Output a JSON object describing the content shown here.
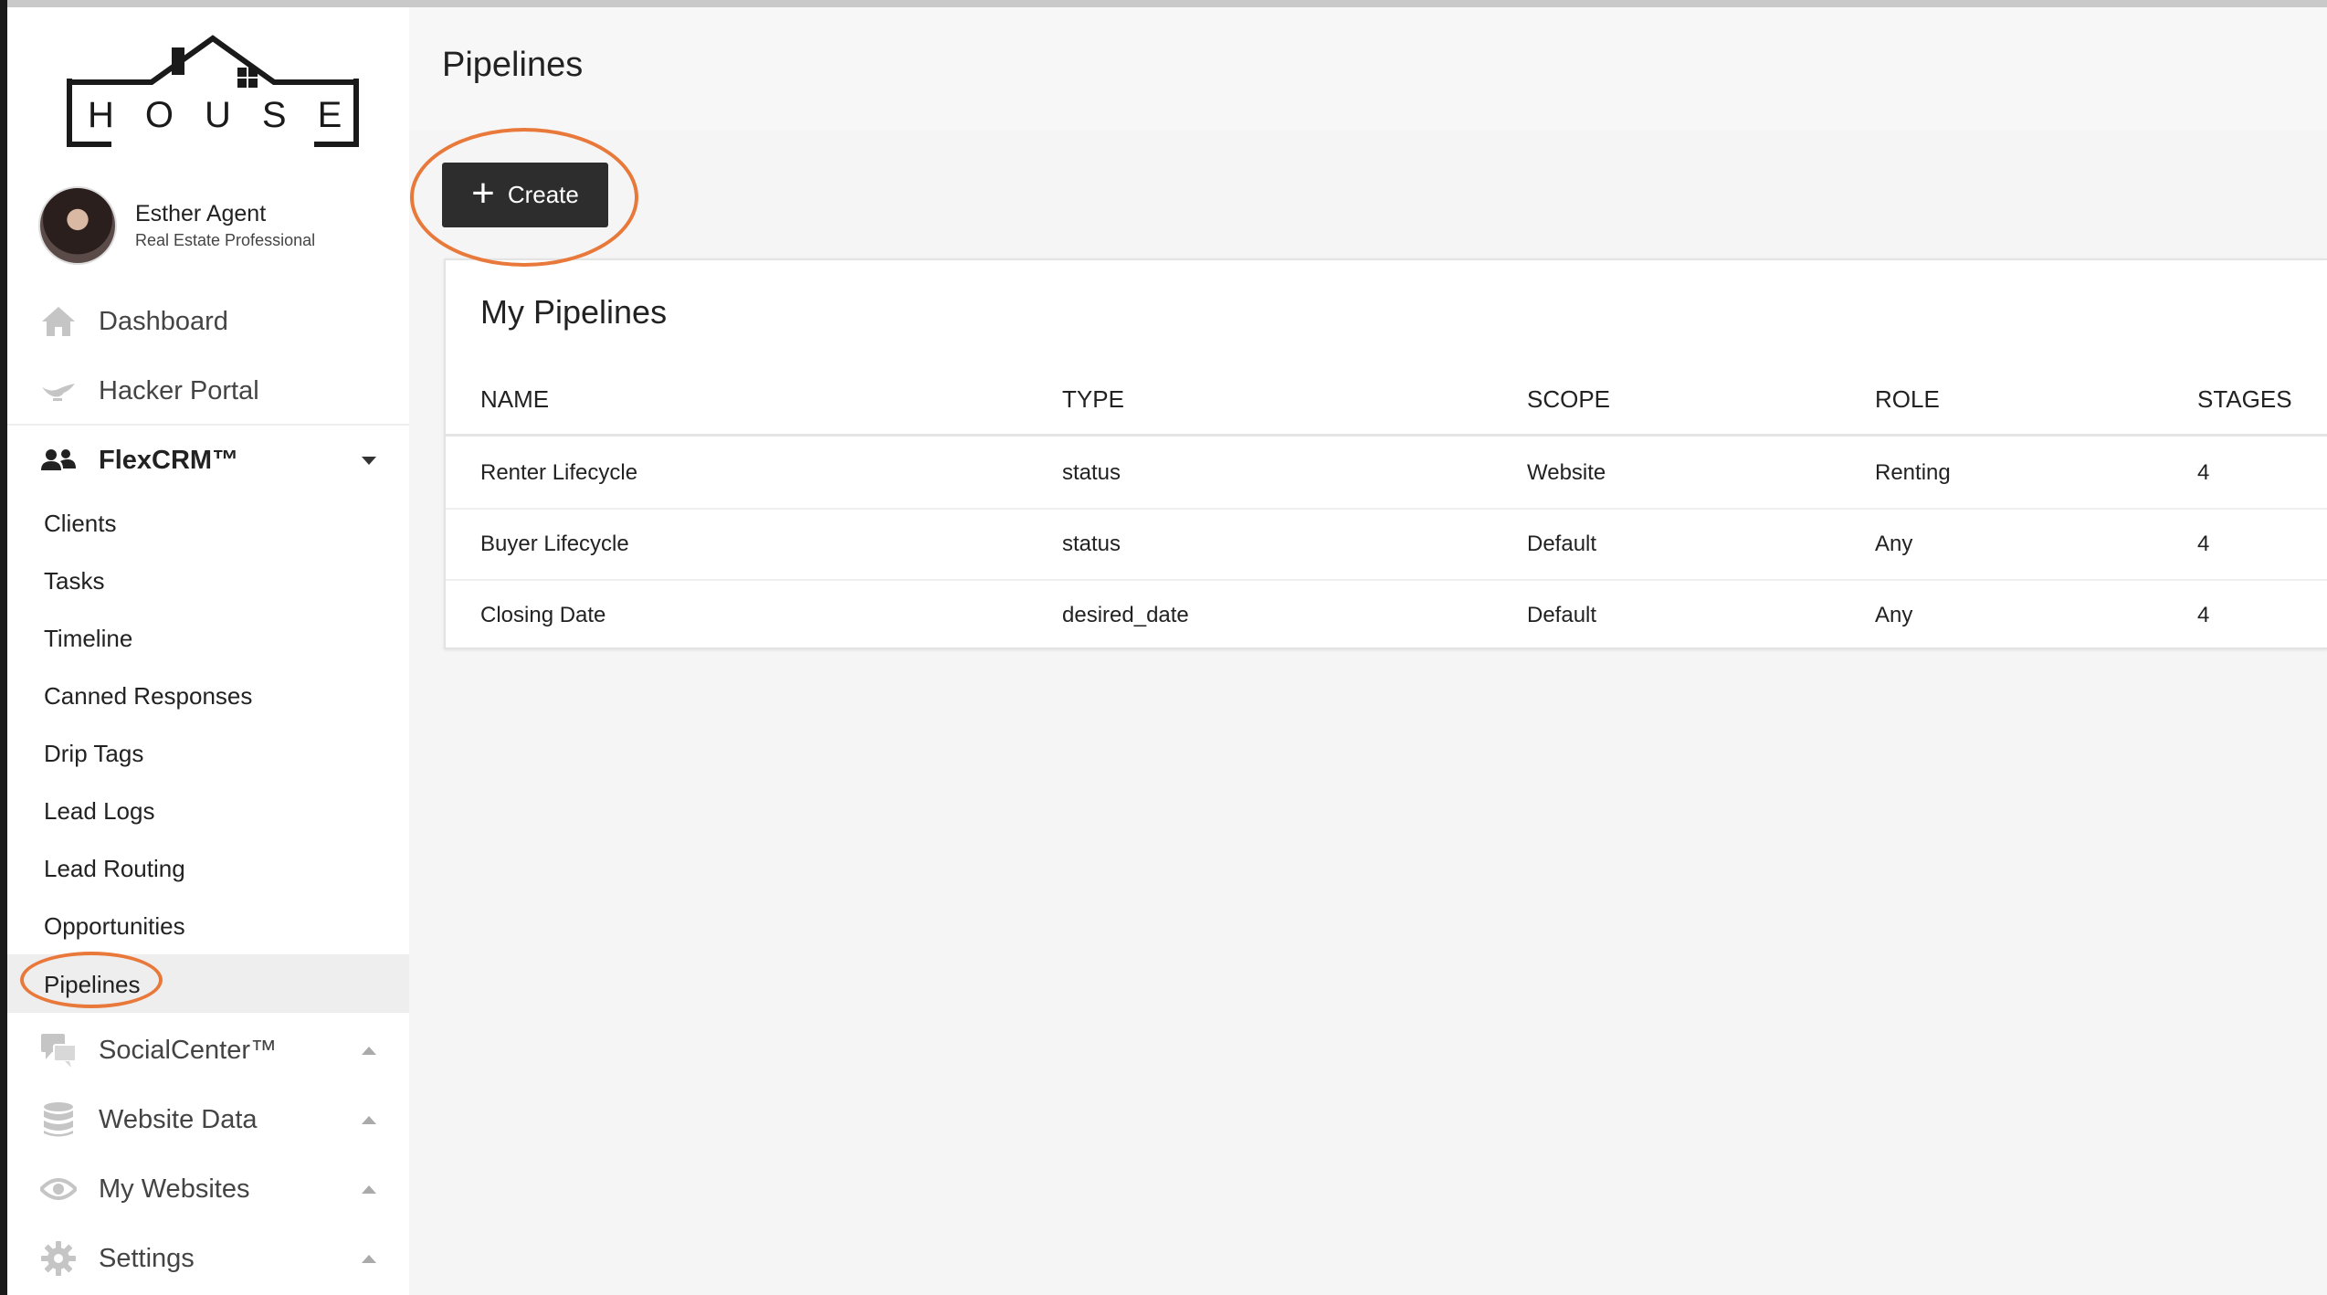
{
  "sidebar": {
    "logo_text": "HOUSE",
    "profile": {
      "name": "Esther Agent",
      "role": "Real Estate Professional"
    },
    "nav": {
      "dashboard": "Dashboard",
      "hacker_portal": "Hacker Portal",
      "flexcrm": "FlexCRM™",
      "socialcenter": "SocialCenter™",
      "website_data": "Website Data",
      "my_websites": "My Websites",
      "settings": "Settings"
    },
    "flexcrm_items": [
      "Clients",
      "Tasks",
      "Timeline",
      "Canned Responses",
      "Drip Tags",
      "Lead Logs",
      "Lead Routing",
      "Opportunities",
      "Pipelines"
    ],
    "active_item": "Pipelines"
  },
  "header": {
    "title": "Pipelines"
  },
  "toolbar": {
    "create_label": "Create"
  },
  "pipelines": {
    "title": "My Pipelines",
    "columns": [
      "NAME",
      "TYPE",
      "SCOPE",
      "ROLE",
      "STAGES"
    ],
    "rows": [
      [
        "Renter Lifecycle",
        "status",
        "Website",
        "Renting",
        "4"
      ],
      [
        "Buyer Lifecycle",
        "status",
        "Default",
        "Any",
        "4"
      ],
      [
        "Closing Date",
        "desired_date",
        "Default",
        "Any",
        "4"
      ]
    ]
  },
  "colors": {
    "accent_annotation": "#e8793a",
    "button": "#2d2d2d",
    "sidebar_active_bar": "#444444"
  }
}
